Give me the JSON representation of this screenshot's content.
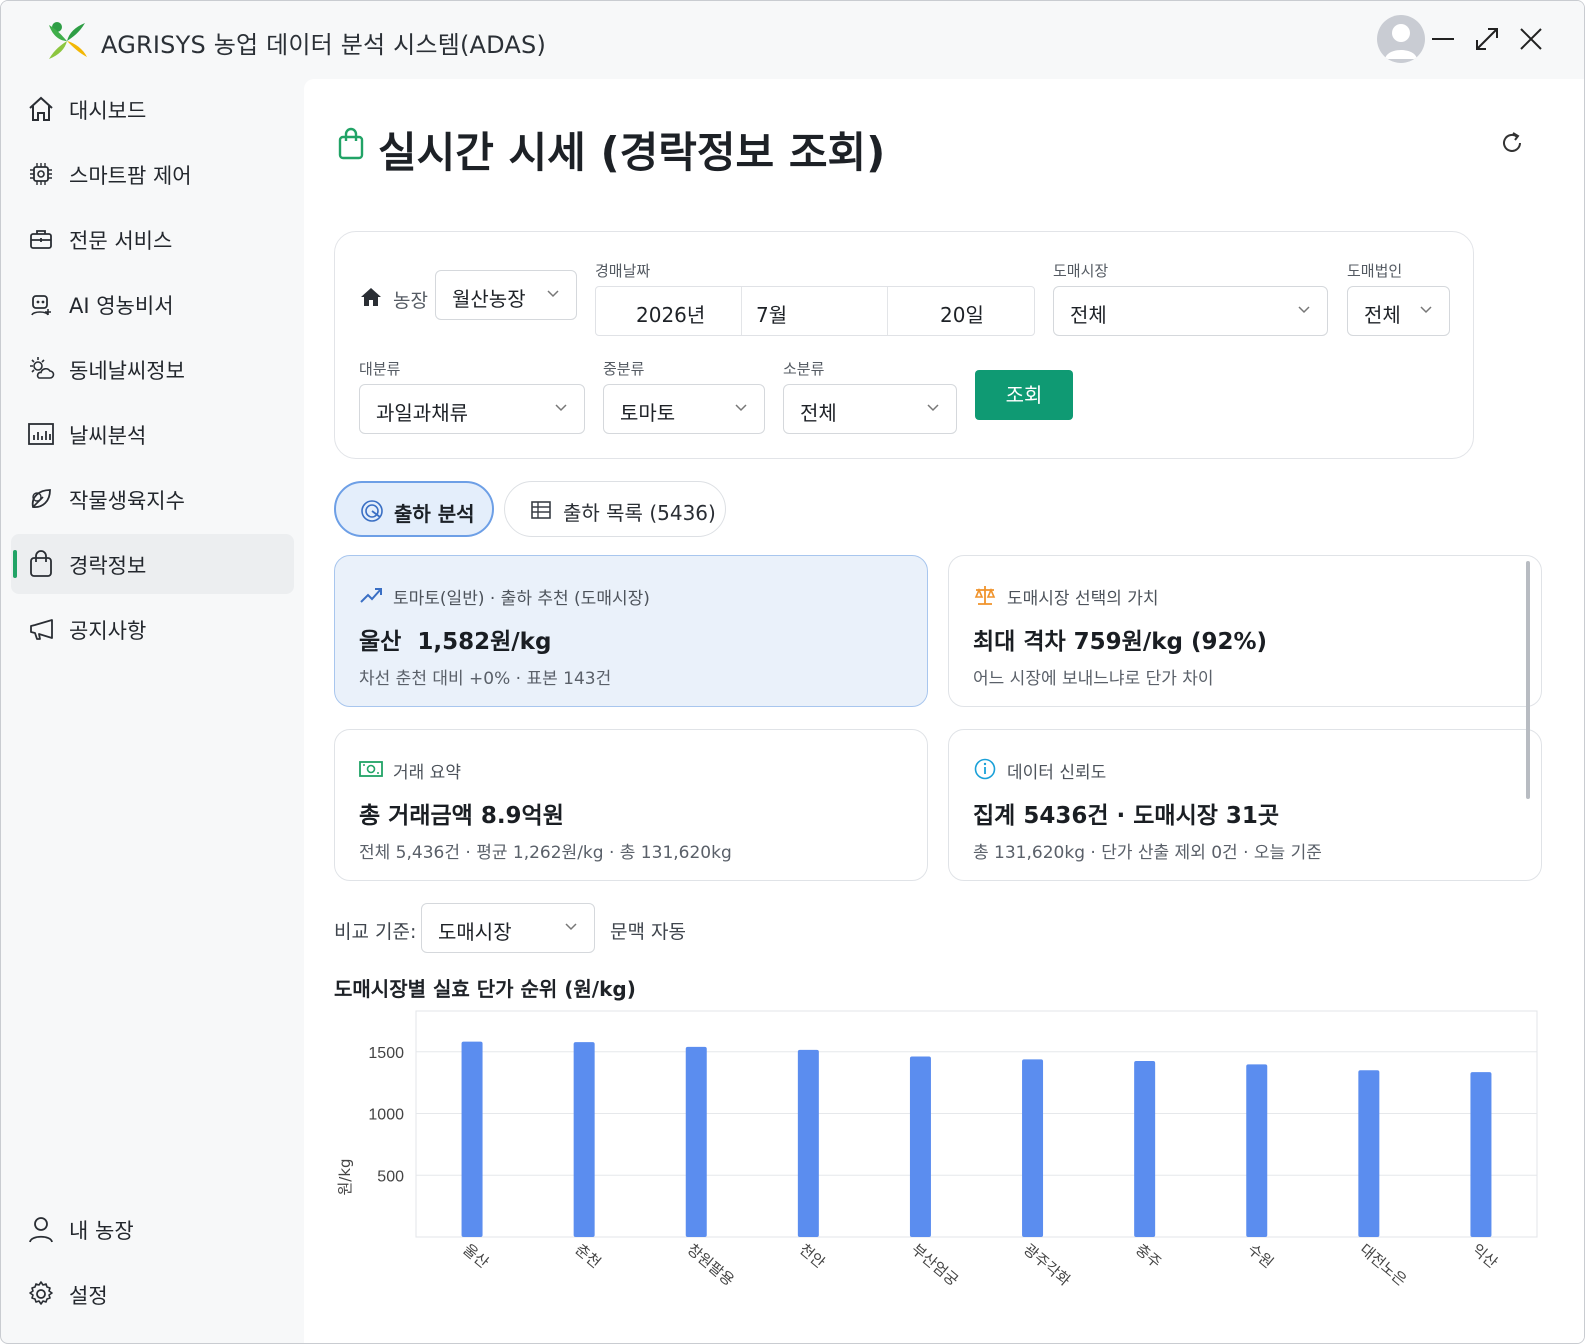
{
  "app": {
    "title": "AGRISYS 농업 데이터 분석 시스템(ADAS)"
  },
  "sidebar": {
    "items": [
      {
        "label": "대시보드",
        "icon": "home-icon"
      },
      {
        "label": "스마트팜 제어",
        "icon": "chip-icon"
      },
      {
        "label": "전문 서비스",
        "icon": "briefcase-icon"
      },
      {
        "label": "AI 영농비서",
        "icon": "robot-icon"
      },
      {
        "label": "동네날씨정보",
        "icon": "sun-cloud-icon"
      },
      {
        "label": "날씨분석",
        "icon": "bar-chart-icon"
      },
      {
        "label": "작물생육지수",
        "icon": "leaf-icon"
      },
      {
        "label": "경락정보",
        "icon": "shopping-bag-icon",
        "active": true
      },
      {
        "label": "공지사항",
        "icon": "megaphone-icon"
      }
    ],
    "bottom": [
      {
        "label": "내 농장",
        "icon": "user-icon"
      },
      {
        "label": "설정",
        "icon": "gear-icon"
      }
    ]
  },
  "page": {
    "title": "실시간 시세 (경락정보 조회)"
  },
  "filters": {
    "farm_label": "농장",
    "farm_value": "월산농장",
    "date_label": "경매날짜",
    "year": "2026년",
    "month": "7월",
    "day": "20일",
    "market_label": "도매시장",
    "market_value": "전체",
    "corp_label": "도매법인",
    "corp_value": "전체",
    "major_label": "대분류",
    "major_value": "과일과채류",
    "middle_label": "중분류",
    "middle_value": "토마토",
    "minor_label": "소분류",
    "minor_value": "전체",
    "query_label": "조회"
  },
  "tabs": [
    {
      "label": "출하 분석",
      "active": true
    },
    {
      "label": "출하 목록 (5436)",
      "active": false
    }
  ],
  "cards": {
    "recommend": {
      "title": "토마토(일반) · 출하 추천 (도매시장)",
      "main": "울산  1,582원/kg",
      "sub": "차선 춘천 대비 +0% · 표본 143건"
    },
    "value": {
      "title": "도매시장 선택의 가치",
      "main": "최대 격차 759원/kg (92%)",
      "sub": "어느 시장에 보내느냐로 단가 차이"
    },
    "summary": {
      "title": "거래 요약",
      "main": "총 거래금액 8.9억원",
      "sub": "전체 5,436건 · 평균 1,262원/kg · 총 131,620kg"
    },
    "reliability": {
      "title": "데이터 신뢰도",
      "main": "집계 5436건 · 도매시장 31곳",
      "sub": "총 131,620kg · 단가 산출 제외 0건 · 오늘 기준"
    }
  },
  "compare": {
    "label": "비교 기준:",
    "value": "도매시장",
    "note": "문맥 자동"
  },
  "colors": {
    "accent": "#0f9a73",
    "bar": "#5b8def",
    "active_nav": "#21a366"
  },
  "chart_data": {
    "type": "bar",
    "title": "도매시장별 실효 단가 순위 (원/kg)",
    "ylabel": "원/kg",
    "categories": [
      "울산",
      "춘천",
      "창원팔용",
      "천안",
      "부산엄궁",
      "광주각화",
      "충주",
      "수원",
      "대전노은",
      "익산"
    ],
    "values": [
      1582,
      1578,
      1540,
      1515,
      1462,
      1438,
      1425,
      1398,
      1350,
      1335
    ],
    "yticks": [
      500,
      1000,
      1500
    ],
    "ylim": [
      0,
      1830
    ],
    "grid": true
  }
}
